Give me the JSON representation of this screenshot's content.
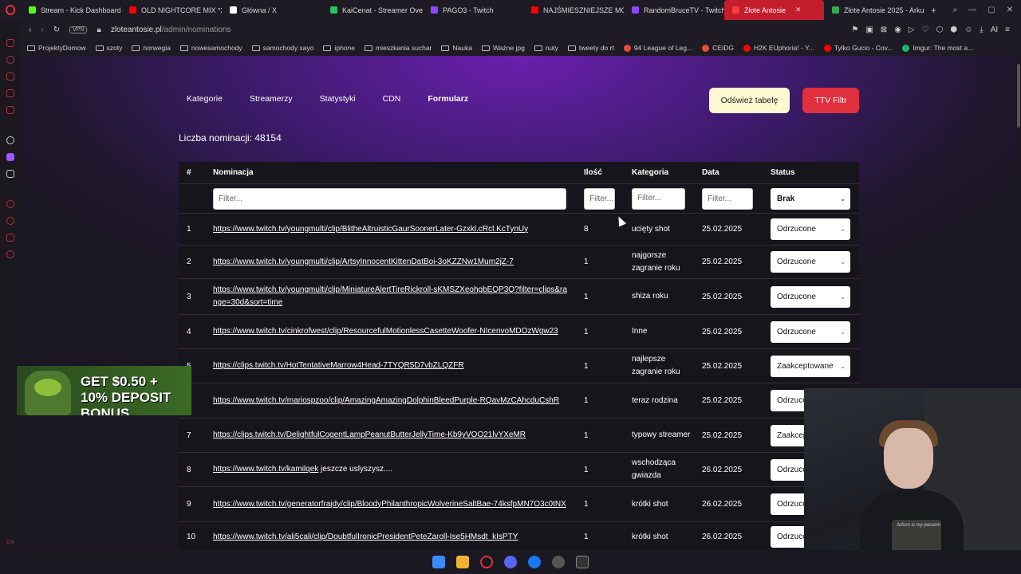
{
  "tabs": [
    {
      "label": "Stream - Kick Dashboard",
      "color": "#53fc18"
    },
    {
      "label": "OLD NIGHTCORE MIX *2",
      "color": "#ff0000"
    },
    {
      "label": "Główna / X",
      "color": "#ffffff"
    },
    {
      "label": "KaiCenat - Streamer Ove",
      "color": "#2dbe60"
    },
    {
      "label": "PAGO3 - Twitch",
      "color": "#9146ff"
    },
    {
      "label": "NAJŚMIESZNIEJSZE MO",
      "color": "#ff0000"
    },
    {
      "label": "RandomBruceTV - Twitch",
      "color": "#9146ff"
    },
    {
      "label": "Złote Antosie",
      "color": "#ff3b3b",
      "active": true
    },
    {
      "label": "Złote Antosie 2025 - Arku",
      "color": "#34a853"
    }
  ],
  "address": {
    "vpn": "VPN",
    "domain": "zloteantosie.pl",
    "path": "/admin/nominations"
  },
  "bookmarks": [
    {
      "label": "ProjektyDomow",
      "type": "folder"
    },
    {
      "label": "szoty",
      "type": "folder"
    },
    {
      "label": "norwegia",
      "type": "folder"
    },
    {
      "label": "nowesamochody",
      "type": "folder"
    },
    {
      "label": "samochody xayo",
      "type": "folder"
    },
    {
      "label": "iphone",
      "type": "folder"
    },
    {
      "label": "mieszkania suchar",
      "type": "folder"
    },
    {
      "label": "Nauka",
      "type": "folder"
    },
    {
      "label": "Ważne jpg",
      "type": "folder"
    },
    {
      "label": "nuty",
      "type": "folder"
    },
    {
      "label": "tweety do rt",
      "type": "folder"
    },
    {
      "label": "94 League of Leg...",
      "type": "site",
      "color": "#e74c3c"
    },
    {
      "label": "CEIDG",
      "type": "site",
      "color": "#e74c3c"
    },
    {
      "label": "H2K EUphoria! - Y...",
      "type": "site",
      "color": "#ff0000"
    },
    {
      "label": "Tylko Gucio - Cov...",
      "type": "site",
      "color": "#ff0000"
    },
    {
      "label": "Imgur: The most a...",
      "type": "site",
      "color": "#1bb76e"
    }
  ],
  "nav": [
    "Kategorie",
    "Streamerzy",
    "Statystyki",
    "CDN",
    "Formularz"
  ],
  "buttons": {
    "refresh": "Odśwież tabelę",
    "ttv": "TTV Filtr"
  },
  "count_label": "Liczba nominacji: 48154",
  "table": {
    "headers": {
      "num": "#",
      "nominacja": "Nominacja",
      "ilosc": "Ilość",
      "kategoria": "Kategoria",
      "data": "Data",
      "status": "Status"
    },
    "filters": {
      "nominacja": "Filter...",
      "ilosc": "Filter...",
      "kategoria": "Filter...",
      "data": "Filter...",
      "status": "Brak"
    },
    "rows": [
      {
        "num": "1",
        "link": "https://www.twitch.tv/youngmulti/clip/BlitheAltruisticGaurSoonerLater-Gzxkl.cRcl.KcTynUy",
        "text": "",
        "ilosc": "8",
        "kategoria": "ucięty shot",
        "data": "25.02.2025",
        "status": "Odrzucone"
      },
      {
        "num": "2",
        "link": "https://www.twitch.tv/youngmulti/clip/ArtsyInnocentKittenDatBoi-3oKZZNw1Mum2jZ-7",
        "text": "",
        "ilosc": "1",
        "kategoria": "najgorsze zagranie roku",
        "data": "25.02.2025",
        "status": "Odrzucone"
      },
      {
        "num": "3",
        "link": "https://www.twitch.tv/youngmulti/clip/MiniatureAlertTireRickroll-sKMSZXeohgbEQP3Q?filter=clips&range=30d&sort=time",
        "text": "",
        "ilosc": "1",
        "kategoria": "shiza roku",
        "data": "25.02.2025",
        "status": "Odrzucone"
      },
      {
        "num": "4",
        "link": "https://www.twitch.tv/cinkrofwest/clip/ResourcefulMotionlessCasetteWoofer-NIcenvoMDOzWgw23",
        "text": "",
        "ilosc": "1",
        "kategoria": "Inne",
        "data": "25.02.2025",
        "status": "Odrzucone"
      },
      {
        "num": "5",
        "link": "https://clips.twitch.tv/HotTentativeMarrow4Head-7TYQR5D7vbZLQZFR",
        "text": "",
        "ilosc": "1",
        "kategoria": "najlepsze zagranie roku",
        "data": "25.02.2025",
        "status": "Zaakceptowane"
      },
      {
        "num": "6",
        "link": "https://www.twitch.tv/mariospzoo/clip/AmazingAmazingDolphinBleedPurple-RQavMzCAhcduCshR",
        "text": "",
        "ilosc": "1",
        "kategoria": "teraz rodzina",
        "data": "25.02.2025",
        "status": "Odrzucone"
      },
      {
        "num": "7",
        "link": "https://clips.twitch.tv/DelightfulCogentLampPeanutButterJellyTime-Kb9yVOO21lvYXeMR",
        "text": "",
        "ilosc": "1",
        "kategoria": "typowy streamer",
        "data": "25.02.2025",
        "status": "Zaakceptowane"
      },
      {
        "num": "8",
        "link": "https://www.twitch.tv/kamilqek",
        "text": " jeszcze uslyszysz....",
        "ilosc": "1",
        "kategoria": "wschodząca gwiazda",
        "data": "26.02.2025",
        "status": "Odrzucone"
      },
      {
        "num": "9",
        "link": "https://www.twitch.tv/generatorfrajdy/clip/BloodyPhilanthropicWolverineSaltBae-74ksfpMN7O3c0tNX",
        "text": "",
        "ilosc": "1",
        "kategoria": "krótki shot",
        "data": "26.02.2025",
        "status": "Odrzucone"
      },
      {
        "num": "10",
        "link": "https://www.twitch.tv/ali5cali/clip/DoubtfulIronicPresidentPeteZaroll-Ise5HMsdt_kIsPTY",
        "text": "",
        "ilosc": "1",
        "kategoria": "krótki shot",
        "data": "26.02.2025",
        "status": "Odrzucone"
      }
    ]
  },
  "ad": {
    "text": "GET $0.50 + 10% DEPOSIT BONUS"
  },
  "webcam": {
    "mug_text": "Artism is my passion"
  },
  "sidebar_bottom": "GX"
}
